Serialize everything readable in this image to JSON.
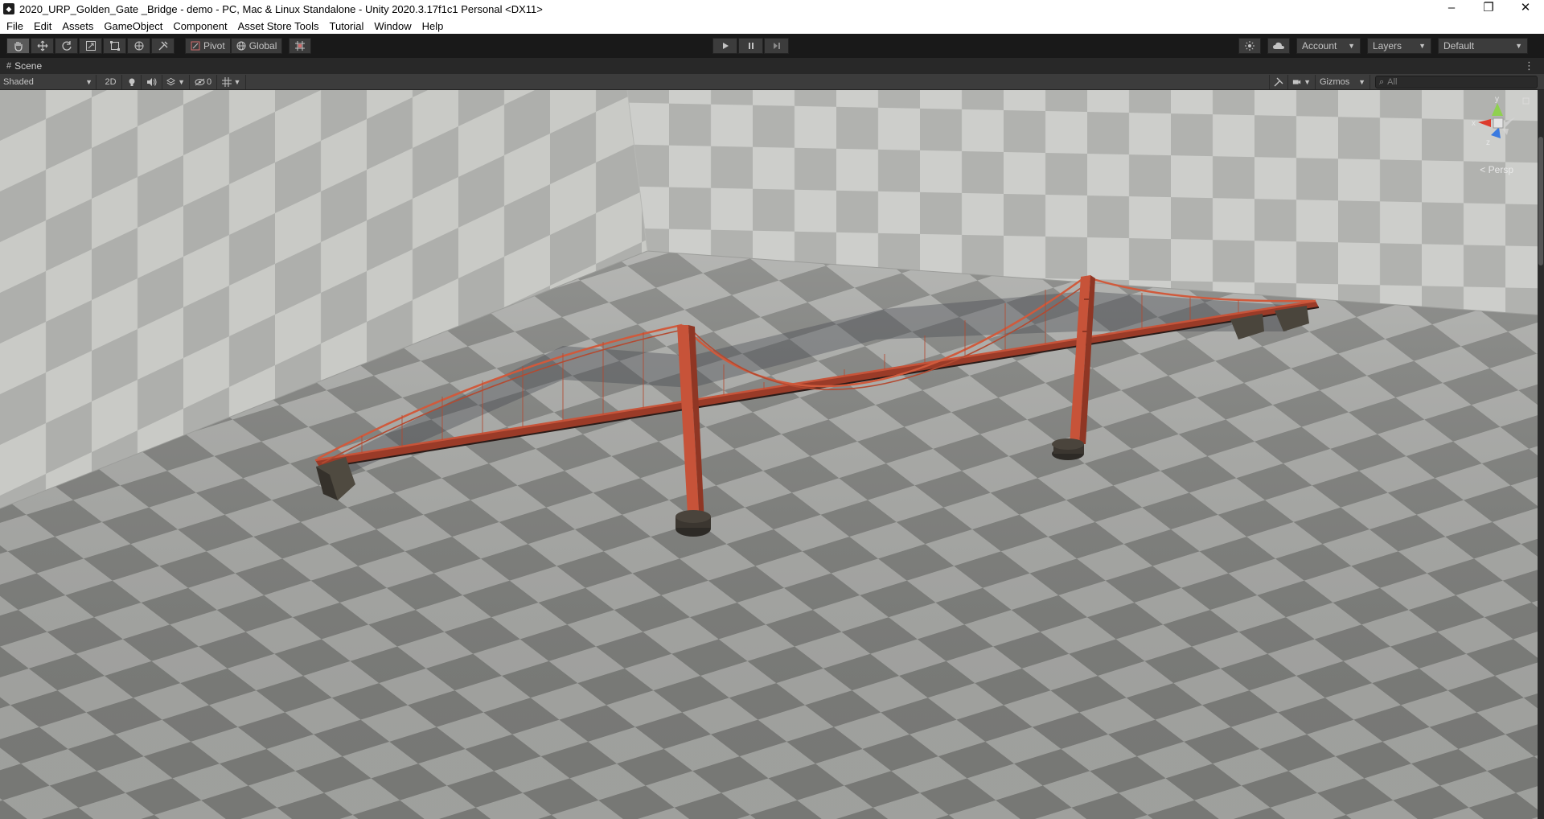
{
  "window": {
    "title": "2020_URP_Golden_Gate _Bridge - demo - PC, Mac & Linux Standalone - Unity 2020.3.17f1c1 Personal <DX11>",
    "minimize_glyph": "–",
    "maximize_glyph": "❐",
    "close_glyph": "✕"
  },
  "menu": [
    "File",
    "Edit",
    "Assets",
    "GameObject",
    "Component",
    "Asset Store Tools",
    "Tutorial",
    "Window",
    "Help"
  ],
  "toolbar": {
    "pivot_label": "Pivot",
    "global_label": "Global",
    "account_label": "Account",
    "layers_label": "Layers",
    "layout_label": "Default"
  },
  "scene_tab": {
    "label": "Scene"
  },
  "scene_toolbar": {
    "shading_mode": "Shaded",
    "mode_2d": "2D",
    "hidden_count": "0",
    "gizmos_label": "Gizmos",
    "search_placeholder": "All"
  },
  "viewport": {
    "projection_label": "< Persp",
    "axis_x": "x",
    "axis_y": "y",
    "axis_z": "z",
    "bridge_color": "#d05a3c"
  }
}
